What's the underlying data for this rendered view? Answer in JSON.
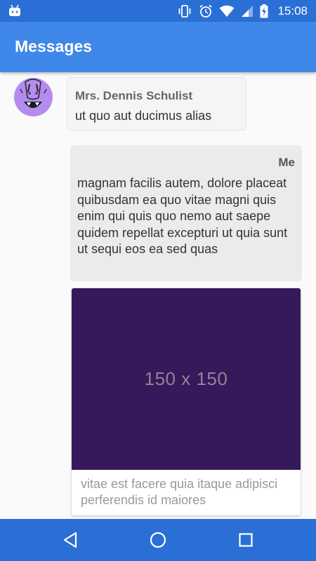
{
  "status_bar": {
    "time": "15:08",
    "icons": [
      "android-icon",
      "vibrate-icon",
      "alarm-icon",
      "wifi-icon",
      "cell-signal-icon",
      "battery-charging-icon"
    ]
  },
  "app_bar": {
    "title": "Messages"
  },
  "messages": [
    {
      "sender": "Mrs. Dennis Schulist",
      "text": "ut quo aut ducimus alias",
      "direction": "incoming",
      "avatar": "monster-avatar"
    },
    {
      "sender": "Me",
      "text": "magnam facilis autem, dolore placeat quibusdam ea quo vitae magni quis enim qui quis quo nemo aut saepe\nquidem repellat excepturi ut quia sunt ut sequi eos ea sed quas",
      "direction": "outgoing",
      "image": {
        "placeholder_text": "150 x 150",
        "caption": "vitae est facere quia itaque adipisci perferendis id maiores"
      }
    }
  ],
  "nav_bar": {
    "buttons": [
      "back-icon",
      "home-icon",
      "recents-icon"
    ]
  },
  "colors": {
    "status_bar": "#2a6fd6",
    "app_bar": "#3f87e8",
    "nav_bar": "#2a6fd6",
    "avatar_bg": "#b48cf0",
    "image_placeholder": "#36195a"
  }
}
